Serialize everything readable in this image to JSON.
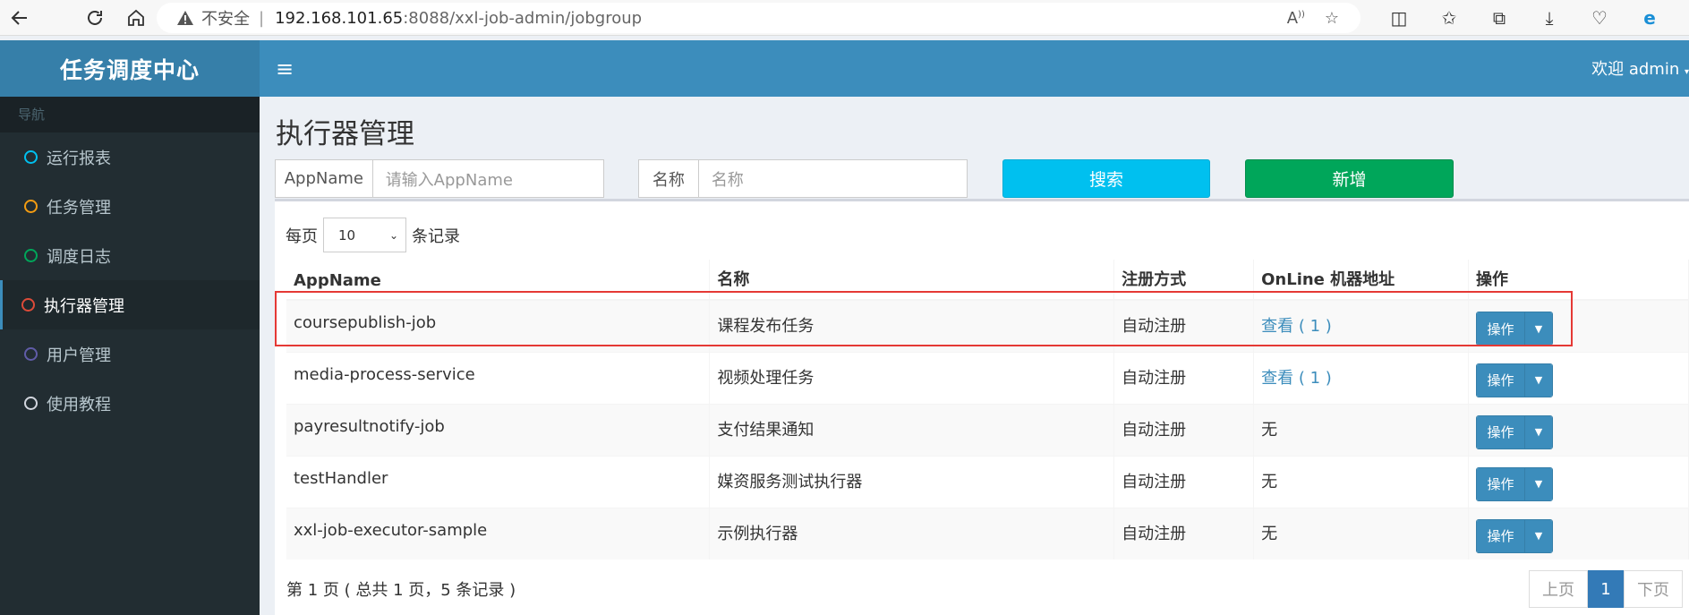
{
  "browser": {
    "insecure_label": "不安全",
    "url_host": "192.168.101.65",
    "url_rest": ":8088/xxl-job-admin/jobgroup"
  },
  "sidebar": {
    "logo": "任务调度中心",
    "nav_header": "导航",
    "items": [
      {
        "label": "运行报表",
        "color": "#00c0ef"
      },
      {
        "label": "任务管理",
        "color": "#f39c12"
      },
      {
        "label": "调度日志",
        "color": "#00a65a"
      },
      {
        "label": "执行器管理",
        "color": "#dd4b39"
      },
      {
        "label": "用户管理",
        "color": "#605ca8"
      },
      {
        "label": "使用教程",
        "color": "#d2d6de"
      }
    ]
  },
  "topbar": {
    "welcome": "欢迎 admin"
  },
  "main": {
    "title": "执行器管理",
    "search": {
      "appname_label": "AppName",
      "appname_placeholder": "请输入AppName",
      "name_label": "名称",
      "name_placeholder": "名称",
      "search_button": "搜索",
      "add_button": "新增"
    },
    "perpage": {
      "prefix": "每页",
      "value": "10",
      "suffix": "条记录"
    },
    "table": {
      "headers": [
        "AppName",
        "名称",
        "注册方式",
        "OnLine 机器地址",
        "操作"
      ],
      "rows": [
        {
          "appname": "coursepublish-job",
          "name": "课程发布任务",
          "reg": "自动注册",
          "online": "查看 ( 1 )",
          "op": "操作"
        },
        {
          "appname": "media-process-service",
          "name": "视频处理任务",
          "reg": "自动注册",
          "online": "查看 ( 1 )",
          "op": "操作"
        },
        {
          "appname": "payresultnotify-job",
          "name": "支付结果通知",
          "reg": "自动注册",
          "online": "无",
          "op": "操作"
        },
        {
          "appname": "testHandler",
          "name": "媒资服务测试执行器",
          "reg": "自动注册",
          "online": "无",
          "op": "操作"
        },
        {
          "appname": "xxl-job-executor-sample",
          "name": "示例执行器",
          "reg": "自动注册",
          "online": "无",
          "op": "操作"
        }
      ]
    },
    "footer_info": "第 1 页 ( 总共 1 页，5 条记录 )",
    "pager": {
      "prev": "上页",
      "current": "1",
      "next": "下页"
    }
  }
}
